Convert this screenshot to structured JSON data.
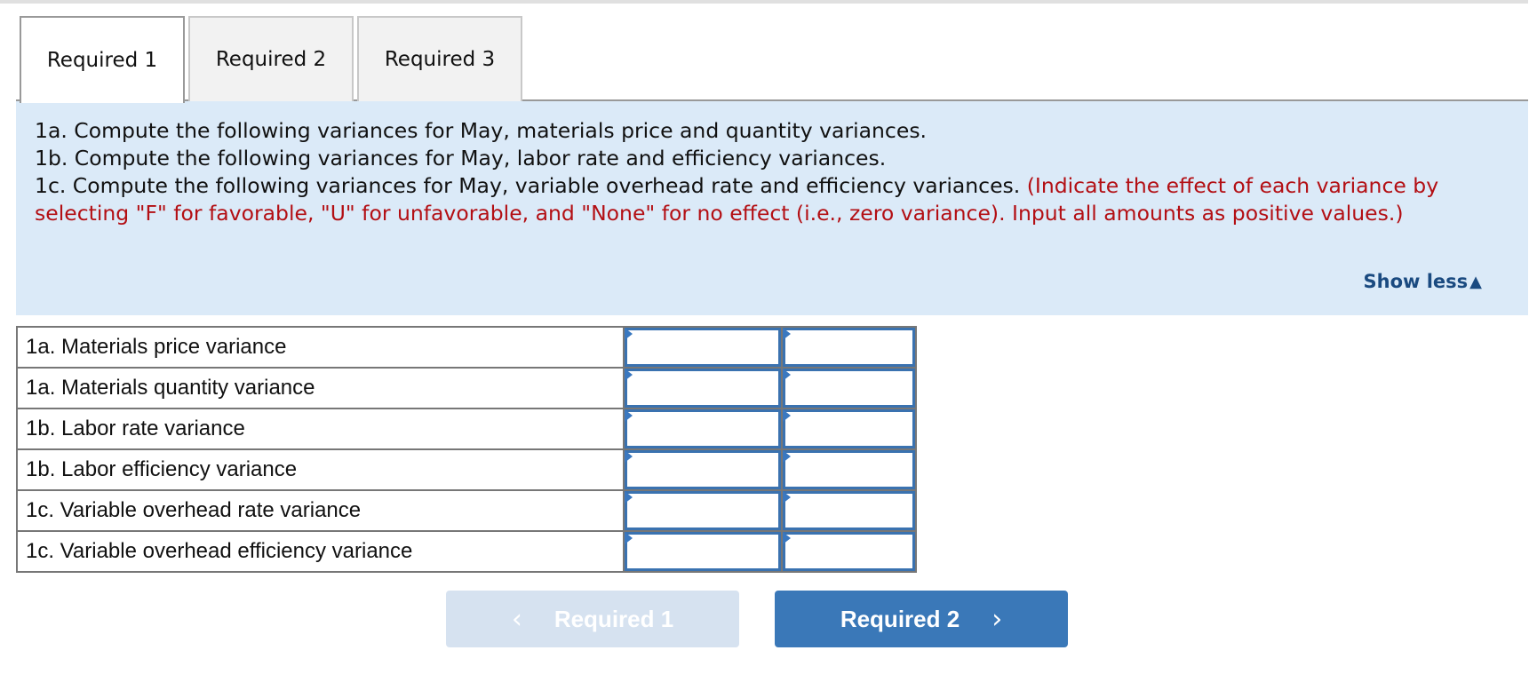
{
  "tabs": [
    {
      "label": "Required 1",
      "active": true
    },
    {
      "label": "Required 2",
      "active": false
    },
    {
      "label": "Required 3",
      "active": false
    }
  ],
  "instructions": {
    "line_1a": "1a. Compute the following variances for May, materials price and quantity variances.",
    "line_1b": "1b. Compute the following variances for May, labor rate and efficiency variances.",
    "line_1c": "1c. Compute the following variances for May, variable overhead rate and efficiency variances.",
    "note": "(Indicate the effect of each variance by selecting \"F\" for favorable, \"U\" for unfavorable, and \"None\" for no effect (i.e., zero variance). Input all amounts as positive values.)",
    "show_less_label": "Show less",
    "show_less_icon": "▲"
  },
  "table": {
    "rows": [
      {
        "label": "1a. Materials price variance",
        "amount": "",
        "effect": ""
      },
      {
        "label": "1a. Materials quantity variance",
        "amount": "",
        "effect": ""
      },
      {
        "label": "1b. Labor rate variance",
        "amount": "",
        "effect": ""
      },
      {
        "label": "1b. Labor efficiency variance",
        "amount": "",
        "effect": ""
      },
      {
        "label": "1c. Variable overhead rate variance",
        "amount": "",
        "effect": ""
      },
      {
        "label": "1c. Variable overhead efficiency variance",
        "amount": "",
        "effect": ""
      }
    ]
  },
  "navigation": {
    "prev_label": "Required 1",
    "prev_icon": "‹",
    "prev_enabled": false,
    "next_label": "Required 2",
    "next_icon": "›",
    "next_enabled": true
  },
  "colors": {
    "panel_bg": "#dbeaf8",
    "note_red": "#b30f14",
    "link_blue": "#1a4a80",
    "input_border": "#3a72b0",
    "next_button": "#3a78b8",
    "prev_button_disabled": "#d6e2f0"
  }
}
